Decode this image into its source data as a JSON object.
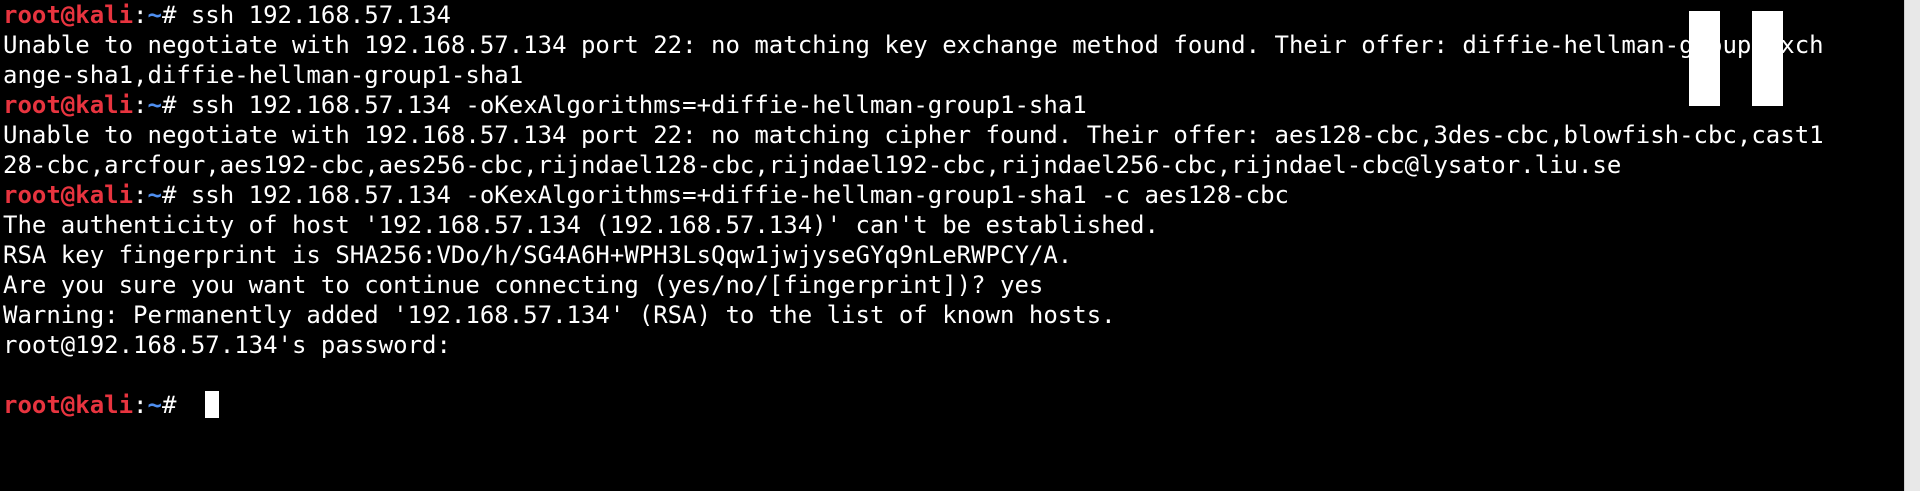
{
  "terminal": {
    "prompt_user": "root@kali",
    "prompt_sep": ":",
    "prompt_path": "~",
    "prompt_sym": "# ",
    "lines": [
      {
        "type": "prompt",
        "cmd": "ssh 192.168.57.134"
      },
      {
        "type": "out",
        "text": "Unable to negotiate with 192.168.57.134 port 22: no matching key exchange method found. Their offer: diffie-hellman-group-exch"
      },
      {
        "type": "out",
        "text": "ange-sha1,diffie-hellman-group1-sha1"
      },
      {
        "type": "prompt",
        "cmd": "ssh 192.168.57.134 -oKexAlgorithms=+diffie-hellman-group1-sha1"
      },
      {
        "type": "out",
        "text": "Unable to negotiate with 192.168.57.134 port 22: no matching cipher found. Their offer: aes128-cbc,3des-cbc,blowfish-cbc,cast1"
      },
      {
        "type": "out",
        "text": "28-cbc,arcfour,aes192-cbc,aes256-cbc,rijndael128-cbc,rijndael192-cbc,rijndael256-cbc,rijndael-cbc@lysator.liu.se"
      },
      {
        "type": "prompt",
        "cmd": "ssh 192.168.57.134 -oKexAlgorithms=+diffie-hellman-group1-sha1 -c aes128-cbc"
      },
      {
        "type": "out",
        "text": "The authenticity of host '192.168.57.134 (192.168.57.134)' can't be established."
      },
      {
        "type": "out",
        "text": "RSA key fingerprint is SHA256:VDo/h/SG4A6H+WPH3LsQqw1jwjyseGYq9nLeRWPCY/A."
      },
      {
        "type": "out",
        "text": "Are you sure you want to continue connecting (yes/no/[fingerprint])? yes"
      },
      {
        "type": "out",
        "text": "Warning: Permanently added '192.168.57.134' (RSA) to the list of known hosts."
      },
      {
        "type": "out",
        "text": "root@192.168.57.134's password: "
      },
      {
        "type": "out",
        "text": ""
      },
      {
        "type": "prompt",
        "cmd": ""
      }
    ]
  }
}
